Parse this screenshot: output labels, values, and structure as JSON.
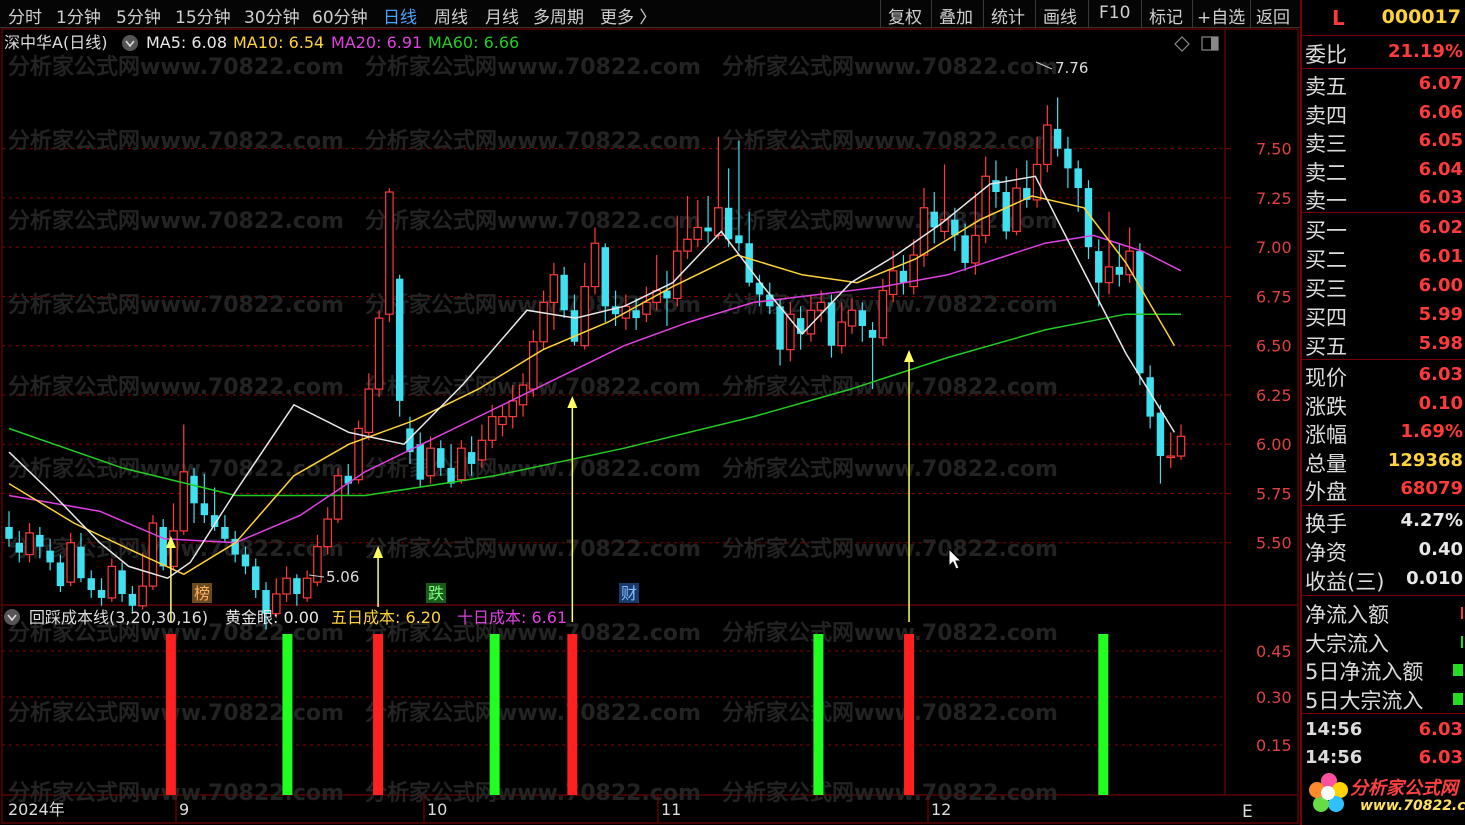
{
  "toolbar": {
    "periods": [
      "分时",
      "1分钟",
      "5分钟",
      "15分钟",
      "30分钟",
      "60分钟",
      "日线",
      "周线",
      "月线",
      "多周期",
      "更多 〉"
    ],
    "active_period": "日线",
    "tools": [
      "复权",
      "叠加",
      "统计",
      "画线",
      "F10",
      "标记",
      "+自选",
      "返回"
    ]
  },
  "header": {
    "stock_name": "深中华A(日线)",
    "ma5": "MA5: 6.08",
    "ma10": "MA10: 6.54",
    "ma20": "MA20: 6.91",
    "ma60": "MA60: 6.66"
  },
  "colors": {
    "ma5": "#e8e8e8",
    "ma10": "#ffd23a",
    "ma20": "#e040e0",
    "ma60": "#22cc22",
    "up": "#ff3a3a",
    "down": "#40e0f0",
    "grid": "#8a0000",
    "arrow": "#ffff60"
  },
  "watermark": "分析家公式网www.70822.com",
  "price_axis": [
    "7.50",
    "7.25",
    "7.00",
    "6.75",
    "6.50",
    "6.25",
    "6.00",
    "5.75",
    "5.50"
  ],
  "annotations": {
    "high": "7.76",
    "low": "5.06"
  },
  "tags": [
    {
      "text": "榜",
      "bg": "#6b4a20",
      "fg": "#ffb060"
    },
    {
      "text": "跌",
      "bg": "#1a5a1a",
      "fg": "#80ff80"
    },
    {
      "text": "财",
      "bg": "#1a3a6a",
      "fg": "#80c0ff"
    }
  ],
  "indicator": {
    "name": "回踩成本线(3,20,30,16)",
    "item1": "黄金眼: 0.00",
    "item2": "五日成本: 6.20",
    "item3": "十日成本: 6.61",
    "axis": [
      "0.45",
      "0.30",
      "0.15"
    ]
  },
  "time_axis": {
    "year": "2024年",
    "months": [
      "9",
      "10",
      "11",
      "12"
    ],
    "corner": "E"
  },
  "right_panel": {
    "marker": "L",
    "code": "000017",
    "weibi_label": "委比",
    "weibi_value": "21.19%",
    "sells": [
      {
        "label": "卖五",
        "price": "6.07"
      },
      {
        "label": "卖四",
        "price": "6.06"
      },
      {
        "label": "卖三",
        "price": "6.05"
      },
      {
        "label": "卖二",
        "price": "6.04"
      },
      {
        "label": "卖一",
        "price": "6.03"
      }
    ],
    "buys": [
      {
        "label": "买一",
        "price": "6.02"
      },
      {
        "label": "买二",
        "price": "6.01"
      },
      {
        "label": "买三",
        "price": "6.00"
      },
      {
        "label": "买四",
        "price": "5.99"
      },
      {
        "label": "买五",
        "price": "5.98"
      }
    ],
    "quote": [
      {
        "label": "现价",
        "value": "6.03",
        "color": "red"
      },
      {
        "label": "涨跌",
        "value": "0.10",
        "color": "red"
      },
      {
        "label": "涨幅",
        "value": "1.69%",
        "color": "red"
      },
      {
        "label": "总量",
        "value": "129368",
        "color": "yellow"
      },
      {
        "label": "外盘",
        "value": "68079",
        "color": "red"
      }
    ],
    "stats": [
      {
        "label": "换手",
        "value": "4.27%",
        "color": "white"
      },
      {
        "label": "净资",
        "value": "0.40",
        "color": "white"
      },
      {
        "label": "收益(三)",
        "value": "0.010",
        "color": "white"
      }
    ],
    "flows": [
      "净流入额",
      "大宗流入",
      "5日净流入额",
      "5日大宗流入"
    ],
    "ticks": [
      {
        "time": "14:56",
        "price": "6.03"
      },
      {
        "time": "14:56",
        "price": "6.03"
      }
    ],
    "logo_title": "分析家公式网",
    "logo_url": "www.70822.com"
  },
  "chart_data": {
    "type": "candlestick",
    "ylim": [
      5.25,
      7.95
    ],
    "candles": [
      [
        5.58,
        5.52,
        5.66,
        5.48
      ],
      [
        5.5,
        5.45,
        5.56,
        5.4
      ],
      [
        5.44,
        5.55,
        5.6,
        5.4
      ],
      [
        5.54,
        5.48,
        5.58,
        5.42
      ],
      [
        5.46,
        5.4,
        5.52,
        5.36
      ],
      [
        5.4,
        5.28,
        5.44,
        5.25
      ],
      [
        5.3,
        5.5,
        5.55,
        5.28
      ],
      [
        5.48,
        5.32,
        5.55,
        5.3
      ],
      [
        5.32,
        5.26,
        5.36,
        5.22
      ],
      [
        5.26,
        5.22,
        5.32,
        5.18
      ],
      [
        5.22,
        5.38,
        5.42,
        5.2
      ],
      [
        5.36,
        5.24,
        5.4,
        5.2
      ],
      [
        5.24,
        5.18,
        5.28,
        5.14
      ],
      [
        5.18,
        5.28,
        5.45,
        5.16
      ],
      [
        5.28,
        5.6,
        5.64,
        5.26
      ],
      [
        5.58,
        5.38,
        5.62,
        5.36
      ],
      [
        5.38,
        5.56,
        5.7,
        5.36
      ],
      [
        5.56,
        5.86,
        6.1,
        5.54
      ],
      [
        5.84,
        5.7,
        5.88,
        5.6
      ],
      [
        5.7,
        5.64,
        5.85,
        5.6
      ],
      [
        5.64,
        5.58,
        5.78,
        5.56
      ],
      [
        5.58,
        5.52,
        5.64,
        5.5
      ],
      [
        5.52,
        5.44,
        5.56,
        5.4
      ],
      [
        5.44,
        5.38,
        5.48,
        5.34
      ],
      [
        5.38,
        5.26,
        5.42,
        5.22
      ],
      [
        5.26,
        5.14,
        5.3,
        5.06
      ],
      [
        5.14,
        5.24,
        5.32,
        5.12
      ],
      [
        5.24,
        5.32,
        5.38,
        5.2
      ],
      [
        5.32,
        5.24,
        5.34,
        5.18
      ],
      [
        5.22,
        5.32,
        5.36,
        5.2
      ],
      [
        5.3,
        5.48,
        5.54,
        5.28
      ],
      [
        5.48,
        5.62,
        5.68,
        5.44
      ],
      [
        5.62,
        5.84,
        5.88,
        5.6
      ],
      [
        5.84,
        5.8,
        5.9,
        5.74
      ],
      [
        5.82,
        6.08,
        6.12,
        5.8
      ],
      [
        6.06,
        6.28,
        6.36,
        6.02
      ],
      [
        6.28,
        6.64,
        6.68,
        6.24
      ],
      [
        6.66,
        7.28,
        7.3,
        6.62
      ],
      [
        6.84,
        6.22,
        6.86,
        6.14
      ],
      [
        6.08,
        5.96,
        6.14,
        5.9
      ],
      [
        6.0,
        5.82,
        6.06,
        5.78
      ],
      [
        5.84,
        5.98,
        6.04,
        5.8
      ],
      [
        5.98,
        5.88,
        6.02,
        5.84
      ],
      [
        5.88,
        5.8,
        6.0,
        5.78
      ],
      [
        5.82,
        5.98,
        6.02,
        5.8
      ],
      [
        5.96,
        5.9,
        6.04,
        5.84
      ],
      [
        5.92,
        6.02,
        6.1,
        5.88
      ],
      [
        6.02,
        6.14,
        6.2,
        5.98
      ],
      [
        6.1,
        6.14,
        6.2,
        6.04
      ],
      [
        6.14,
        6.22,
        6.3,
        6.08
      ],
      [
        6.2,
        6.3,
        6.36,
        6.14
      ],
      [
        6.28,
        6.52,
        6.58,
        6.24
      ],
      [
        6.52,
        6.72,
        6.78,
        6.48
      ],
      [
        6.72,
        6.86,
        6.92,
        6.58
      ],
      [
        6.86,
        6.68,
        6.9,
        6.64
      ],
      [
        6.68,
        6.52,
        6.76,
        6.5
      ],
      [
        6.5,
        6.8,
        6.92,
        6.48
      ],
      [
        6.8,
        7.02,
        7.1,
        6.76
      ],
      [
        7.0,
        6.7,
        7.02,
        6.62
      ],
      [
        6.7,
        6.66,
        6.78,
        6.6
      ],
      [
        6.64,
        6.7,
        6.76,
        6.58
      ],
      [
        6.68,
        6.64,
        6.74,
        6.58
      ],
      [
        6.66,
        6.72,
        6.8,
        6.62
      ],
      [
        6.72,
        6.78,
        6.96,
        6.68
      ],
      [
        6.78,
        6.74,
        6.88,
        6.6
      ],
      [
        6.74,
        6.98,
        7.16,
        6.7
      ],
      [
        6.98,
        7.04,
        7.26,
        6.94
      ],
      [
        7.04,
        7.1,
        7.24,
        7.0
      ],
      [
        7.1,
        7.08,
        7.26,
        7.02
      ],
      [
        7.06,
        7.2,
        7.56,
        7.04
      ],
      [
        7.2,
        7.04,
        7.4,
        7.0
      ],
      [
        7.06,
        7.02,
        7.54,
        6.98
      ],
      [
        7.02,
        6.82,
        7.18,
        6.8
      ],
      [
        6.82,
        6.76,
        6.86,
        6.7
      ],
      [
        6.76,
        6.7,
        6.82,
        6.66
      ],
      [
        6.7,
        6.48,
        6.74,
        6.4
      ],
      [
        6.48,
        6.66,
        6.72,
        6.42
      ],
      [
        6.64,
        6.56,
        6.7,
        6.48
      ],
      [
        6.56,
        6.68,
        6.76,
        6.52
      ],
      [
        6.68,
        6.72,
        6.78,
        6.62
      ],
      [
        6.72,
        6.5,
        6.76,
        6.44
      ],
      [
        6.5,
        6.62,
        6.72,
        6.46
      ],
      [
        6.6,
        6.68,
        6.74,
        6.56
      ],
      [
        6.68,
        6.6,
        6.72,
        6.52
      ],
      [
        6.58,
        6.54,
        6.62,
        6.28
      ],
      [
        6.54,
        6.78,
        6.84,
        6.5
      ],
      [
        6.76,
        6.88,
        6.98,
        6.72
      ],
      [
        6.88,
        6.82,
        6.96,
        6.76
      ],
      [
        6.8,
        6.96,
        7.04,
        6.76
      ],
      [
        6.96,
        7.2,
        7.3,
        6.9
      ],
      [
        7.18,
        7.1,
        7.28,
        7.02
      ],
      [
        7.08,
        7.14,
        7.42,
        7.04
      ],
      [
        7.14,
        7.06,
        7.2,
        6.98
      ],
      [
        7.06,
        6.92,
        7.12,
        6.88
      ],
      [
        6.92,
        7.06,
        7.28,
        6.86
      ],
      [
        7.06,
        7.36,
        7.46,
        7.02
      ],
      [
        7.34,
        7.28,
        7.44,
        7.2
      ],
      [
        7.28,
        7.08,
        7.36,
        7.04
      ],
      [
        7.08,
        7.3,
        7.4,
        7.06
      ],
      [
        7.3,
        7.24,
        7.44,
        7.2
      ],
      [
        7.24,
        7.42,
        7.56,
        7.2
      ],
      [
        7.42,
        7.62,
        7.72,
        7.38
      ],
      [
        7.6,
        7.5,
        7.76,
        7.46
      ],
      [
        7.5,
        7.4,
        7.56,
        7.3
      ],
      [
        7.4,
        7.3,
        7.44,
        7.18
      ],
      [
        7.3,
        7.0,
        7.34,
        6.94
      ],
      [
        6.98,
        6.82,
        7.04,
        6.7
      ],
      [
        6.82,
        6.9,
        7.18,
        6.76
      ],
      [
        6.9,
        6.86,
        7.02,
        6.8
      ],
      [
        6.86,
        6.98,
        7.1,
        6.82
      ],
      [
        6.98,
        6.36,
        7.02,
        6.3
      ],
      [
        6.34,
        6.14,
        6.4,
        6.08
      ],
      [
        6.16,
        5.94,
        6.2,
        5.8
      ],
      [
        5.94,
        5.94,
        6.06,
        5.88
      ],
      [
        5.94,
        6.04,
        6.1,
        5.92
      ]
    ],
    "ma5": [
      [
        0,
        5.96
      ],
      [
        14,
        5.74
      ],
      [
        28,
        5.5
      ],
      [
        37,
        5.38
      ],
      [
        49,
        5.32
      ],
      [
        56,
        5.4
      ],
      [
        70,
        5.76
      ],
      [
        88,
        6.2
      ],
      [
        105,
        6.06
      ],
      [
        122,
        6.0
      ],
      [
        140,
        6.3
      ],
      [
        160,
        6.68
      ],
      [
        175,
        6.64
      ],
      [
        190,
        6.7
      ],
      [
        205,
        6.82
      ],
      [
        220,
        7.08
      ],
      [
        233,
        6.8
      ],
      [
        245,
        6.56
      ],
      [
        260,
        6.82
      ],
      [
        274,
        6.96
      ],
      [
        288,
        7.12
      ],
      [
        303,
        7.32
      ],
      [
        317,
        7.36
      ],
      [
        330,
        6.94
      ],
      [
        345,
        6.46
      ],
      [
        360,
        6.06
      ]
    ],
    "ma10": [
      [
        0,
        5.8
      ],
      [
        20,
        5.6
      ],
      [
        38,
        5.46
      ],
      [
        54,
        5.34
      ],
      [
        70,
        5.5
      ],
      [
        88,
        5.84
      ],
      [
        105,
        6.0
      ],
      [
        125,
        6.12
      ],
      [
        145,
        6.28
      ],
      [
        165,
        6.48
      ],
      [
        185,
        6.62
      ],
      [
        205,
        6.8
      ],
      [
        225,
        6.96
      ],
      [
        245,
        6.86
      ],
      [
        262,
        6.82
      ],
      [
        280,
        6.94
      ],
      [
        300,
        7.14
      ],
      [
        316,
        7.26
      ],
      [
        332,
        7.2
      ],
      [
        345,
        6.92
      ],
      [
        360,
        6.5
      ]
    ],
    "ma20": [
      [
        0,
        5.74
      ],
      [
        28,
        5.66
      ],
      [
        48,
        5.52
      ],
      [
        70,
        5.5
      ],
      [
        90,
        5.64
      ],
      [
        110,
        5.86
      ],
      [
        130,
        6.02
      ],
      [
        150,
        6.18
      ],
      [
        170,
        6.34
      ],
      [
        190,
        6.5
      ],
      [
        210,
        6.62
      ],
      [
        230,
        6.72
      ],
      [
        250,
        6.76
      ],
      [
        270,
        6.8
      ],
      [
        290,
        6.86
      ],
      [
        305,
        6.94
      ],
      [
        320,
        7.02
      ],
      [
        335,
        7.06
      ],
      [
        350,
        6.98
      ],
      [
        362,
        6.88
      ]
    ],
    "ma60": [
      [
        0,
        6.08
      ],
      [
        35,
        5.88
      ],
      [
        70,
        5.74
      ],
      [
        110,
        5.74
      ],
      [
        150,
        5.84
      ],
      [
        190,
        5.98
      ],
      [
        230,
        6.14
      ],
      [
        260,
        6.28
      ],
      [
        290,
        6.44
      ],
      [
        320,
        6.58
      ],
      [
        345,
        6.66
      ],
      [
        362,
        6.66
      ]
    ],
    "signals": [
      {
        "x": 50,
        "color": "#ff2020"
      },
      {
        "x": 86,
        "color": "#20ff20"
      },
      {
        "x": 114,
        "color": "#ff2020"
      },
      {
        "x": 150,
        "color": "#20ff20"
      },
      {
        "x": 174,
        "color": "#ff2020"
      },
      {
        "x": 250,
        "color": "#20ff20"
      },
      {
        "x": 278,
        "color": "#ff2020"
      },
      {
        "x": 338,
        "color": "#20ff20"
      }
    ]
  }
}
